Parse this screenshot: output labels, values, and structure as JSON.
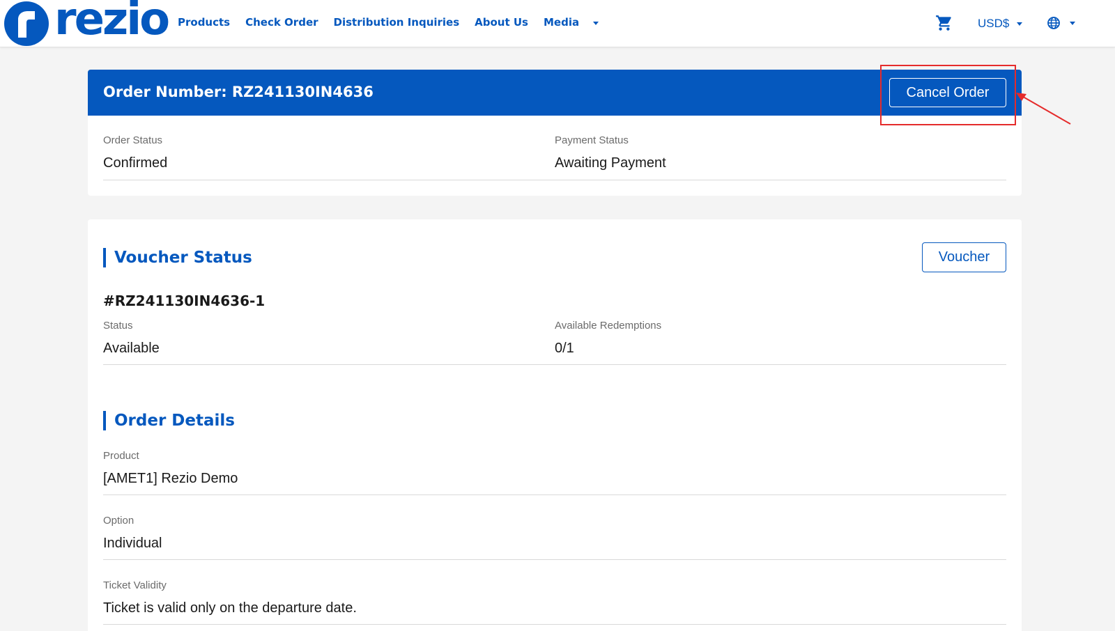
{
  "header": {
    "logo_text": "rezio",
    "nav": [
      "Products",
      "Check Order",
      "Distribution Inquiries",
      "About Us",
      "Media"
    ],
    "currency": "USD$",
    "icons": {
      "cart": "cart-icon",
      "language": "globe-icon",
      "dropdown": "caret-down-icon"
    }
  },
  "order": {
    "title": "Order Number: RZ241130IN4636",
    "cancel_label": "Cancel Order",
    "order_status_label": "Order Status",
    "order_status_value": "Confirmed",
    "payment_status_label": "Payment Status",
    "payment_status_value": "Awaiting Payment"
  },
  "voucher": {
    "title": "Voucher Status",
    "button_label": "Voucher",
    "code": "#RZ241130IN4636-1",
    "status_label": "Status",
    "status_value": "Available",
    "redemptions_label": "Available Redemptions",
    "redemptions_value": "0/1"
  },
  "details": {
    "title": "Order Details",
    "product_label": "Product",
    "product_value": "[AMET1] Rezio Demo",
    "option_label": "Option",
    "option_value": "Individual",
    "validity_label": "Ticket Validity",
    "validity_value": "Ticket is valid only on the departure date."
  },
  "colors": {
    "brand_blue": "#0558be",
    "annotation_red": "#e52b2b",
    "page_background": "#f4f4f4"
  }
}
